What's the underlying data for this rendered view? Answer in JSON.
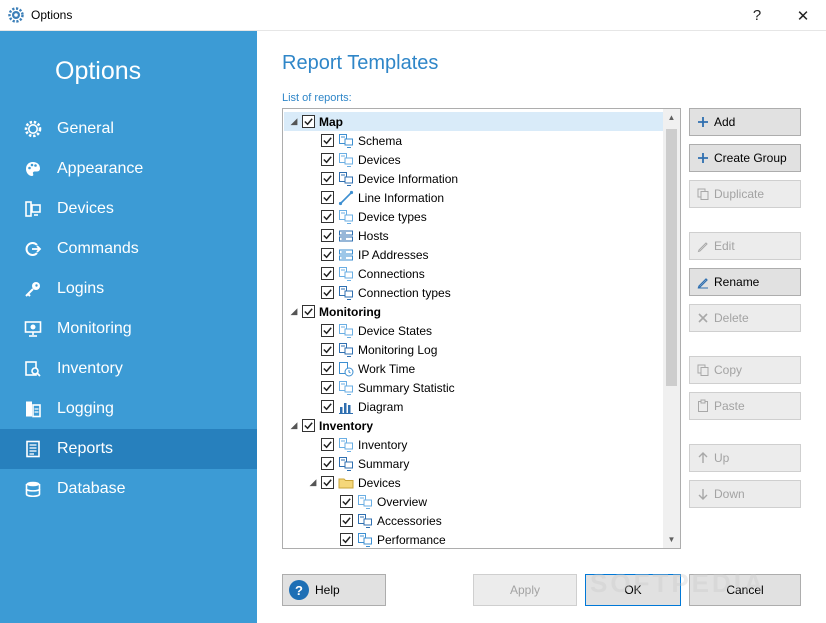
{
  "window": {
    "title": "Options",
    "help_glyph": "?",
    "close_glyph": "✕"
  },
  "sidebar": {
    "title": "Options",
    "items": [
      {
        "label": "General",
        "icon": "gear-icon"
      },
      {
        "label": "Appearance",
        "icon": "palette-icon"
      },
      {
        "label": "Devices",
        "icon": "devices-icon"
      },
      {
        "label": "Commands",
        "icon": "commands-icon"
      },
      {
        "label": "Logins",
        "icon": "key-icon"
      },
      {
        "label": "Monitoring",
        "icon": "monitor-icon"
      },
      {
        "label": "Inventory",
        "icon": "inventory-icon"
      },
      {
        "label": "Logging",
        "icon": "logging-icon"
      },
      {
        "label": "Reports",
        "icon": "reports-icon",
        "active": true
      },
      {
        "label": "Database",
        "icon": "database-icon"
      }
    ]
  },
  "main": {
    "title": "Report Templates",
    "list_label": "List of reports:",
    "tree": [
      {
        "label": "Map",
        "level": 0,
        "group": true,
        "expanded": true,
        "checked": true
      },
      {
        "label": "Schema",
        "level": 1,
        "checked": true,
        "icon": "schema-icon"
      },
      {
        "label": "Devices",
        "level": 1,
        "checked": true,
        "icon": "devices-icon"
      },
      {
        "label": "Device Information",
        "level": 1,
        "checked": true,
        "icon": "device-info-icon"
      },
      {
        "label": "Line Information",
        "level": 1,
        "checked": true,
        "icon": "line-icon"
      },
      {
        "label": "Device types",
        "level": 1,
        "checked": true,
        "icon": "device-types-icon"
      },
      {
        "label": "Hosts",
        "level": 1,
        "checked": true,
        "icon": "hosts-icon"
      },
      {
        "label": "IP Addresses",
        "level": 1,
        "checked": true,
        "icon": "ip-icon"
      },
      {
        "label": "Connections",
        "level": 1,
        "checked": true,
        "icon": "connections-icon"
      },
      {
        "label": "Connection types",
        "level": 1,
        "checked": true,
        "icon": "connection-types-icon"
      },
      {
        "label": "Monitoring",
        "level": 0,
        "group": true,
        "expanded": true,
        "checked": true
      },
      {
        "label": "Device States",
        "level": 1,
        "checked": true,
        "icon": "device-states-icon"
      },
      {
        "label": "Monitoring Log",
        "level": 1,
        "checked": true,
        "icon": "monitoring-log-icon"
      },
      {
        "label": "Work Time",
        "level": 1,
        "checked": true,
        "icon": "clock-icon"
      },
      {
        "label": "Summary Statistic",
        "level": 1,
        "checked": true,
        "icon": "summary-statistic-icon"
      },
      {
        "label": "Diagram",
        "level": 1,
        "checked": true,
        "icon": "diagram-icon"
      },
      {
        "label": "Inventory",
        "level": 0,
        "group": true,
        "expanded": true,
        "checked": true
      },
      {
        "label": "Inventory",
        "level": 1,
        "checked": true,
        "icon": "inventory-icon"
      },
      {
        "label": "Summary",
        "level": 1,
        "checked": true,
        "icon": "summary-icon"
      },
      {
        "label": "Devices",
        "level": 1,
        "checked": true,
        "icon": "folder-icon",
        "expanded": true,
        "hasChildren": true
      },
      {
        "label": "Overview",
        "level": 2,
        "checked": true,
        "icon": "overview-icon"
      },
      {
        "label": "Accessories",
        "level": 2,
        "checked": true,
        "icon": "accessories-icon"
      },
      {
        "label": "Performance",
        "level": 2,
        "checked": true,
        "icon": "performance-icon"
      }
    ]
  },
  "buttons": {
    "add": "Add",
    "create_group": "Create Group",
    "duplicate": "Duplicate",
    "edit": "Edit",
    "rename": "Rename",
    "delete": "Delete",
    "copy": "Copy",
    "paste": "Paste",
    "up": "Up",
    "down": "Down"
  },
  "footer": {
    "help": "Help",
    "apply": "Apply",
    "ok": "OK",
    "cancel": "Cancel"
  },
  "watermark": "SOFTPEDIA",
  "colors": {
    "sidebar": "#3c9bd5",
    "sidebar_active": "#2780bd",
    "accent": "#2f86c8",
    "selection": "#d9ebf9"
  }
}
